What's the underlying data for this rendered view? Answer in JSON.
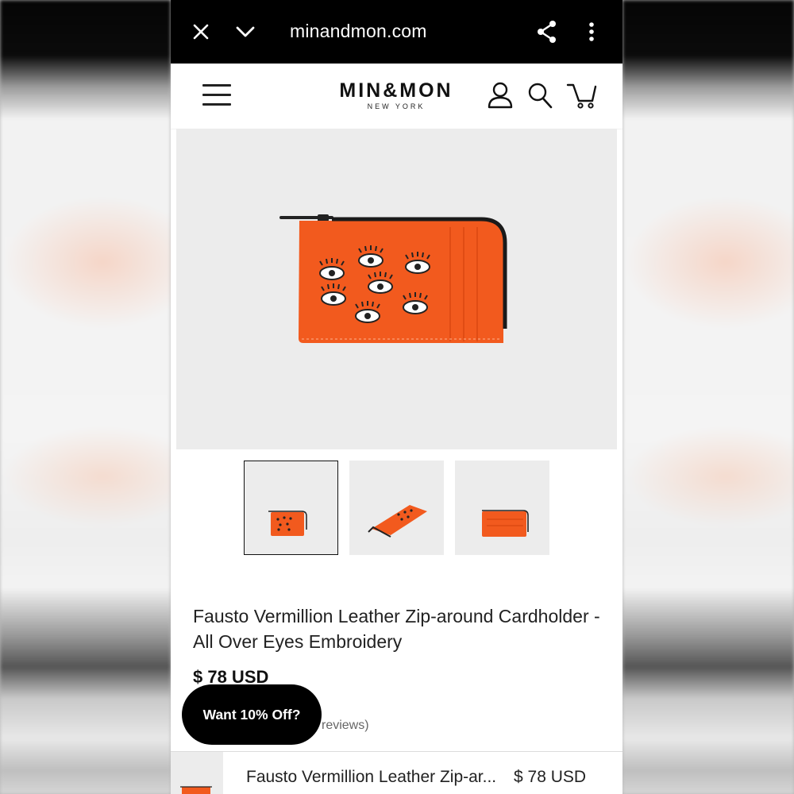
{
  "browser": {
    "url": "minandmon.com",
    "close_icon": "close-icon",
    "collapse_icon": "chevron-down-icon",
    "share_icon": "share-icon",
    "menu_icon": "more-vert-icon"
  },
  "header": {
    "logo_main": "MIN&MON",
    "logo_sub": "NEW YORK",
    "menu_icon": "hamburger-icon",
    "account_icon": "user-icon",
    "search_icon": "search-icon",
    "cart_icon": "cart-icon"
  },
  "product": {
    "title": "Fausto Vermillion Leather Zip-around Cardholder - All Over Eyes Embroidery",
    "price": "$ 78 USD",
    "reviews_text": "reviews)",
    "image_color": "#f25a1e",
    "thumbnails": [
      "front",
      "angled",
      "back"
    ]
  },
  "promo": {
    "label": "Want 10% Off?"
  },
  "sticky_bar": {
    "name": "Fausto Vermillion Leather Zip-ar...",
    "price": "$ 78 USD"
  }
}
